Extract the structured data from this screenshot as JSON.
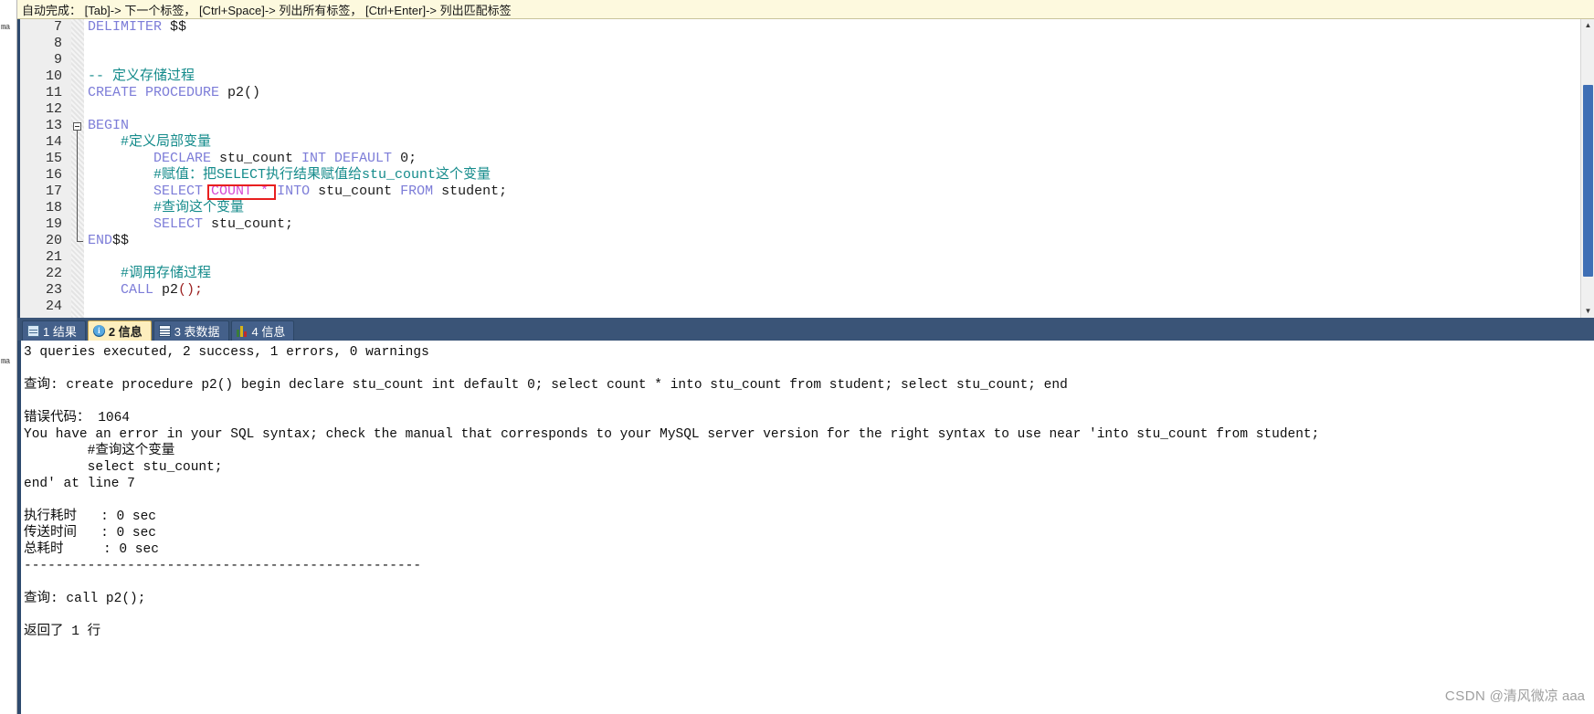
{
  "hint_bar": {
    "text": "自动完成： [Tab]-> 下一个标签， [Ctrl+Space]-> 列出所有标签， [Ctrl+Enter]-> 列出匹配标签"
  },
  "rail": {
    "label_top": "ma",
    "label_bottom": "ma"
  },
  "editor": {
    "lines": [
      {
        "no": "7",
        "segments": [
          {
            "t": "DELIMITER ",
            "c": "kw"
          },
          {
            "t": "$$",
            "c": "idn"
          }
        ]
      },
      {
        "no": "8",
        "segments": []
      },
      {
        "no": "9",
        "segments": []
      },
      {
        "no": "10",
        "segments": [
          {
            "t": "-- 定义存储过程",
            "c": "cmt"
          }
        ]
      },
      {
        "no": "11",
        "segments": [
          {
            "t": "CREATE PROCEDURE ",
            "c": "kw"
          },
          {
            "t": "p2",
            "c": "idn"
          },
          {
            "t": "()",
            "c": "idn"
          }
        ]
      },
      {
        "no": "12",
        "segments": []
      },
      {
        "no": "13",
        "segments": [
          {
            "t": "BEGIN",
            "c": "kw"
          }
        ]
      },
      {
        "no": "14",
        "segments": [
          {
            "t": "    #定义局部变量",
            "c": "cmt"
          }
        ]
      },
      {
        "no": "15",
        "segments": [
          {
            "t": "        DECLARE ",
            "c": "kw"
          },
          {
            "t": "stu_count ",
            "c": "idn"
          },
          {
            "t": "INT DEFAULT ",
            "c": "kw"
          },
          {
            "t": "0;",
            "c": "idn"
          }
        ]
      },
      {
        "no": "16",
        "segments": [
          {
            "t": "        #赋值：把SELECT执行结果赋值给stu_count这个变量",
            "c": "cmt"
          }
        ]
      },
      {
        "no": "17",
        "segments": [
          {
            "t": "        SELECT ",
            "c": "kw"
          },
          {
            "t": "COUNT *",
            "c": "hl"
          },
          {
            "t": " ",
            "c": "idn"
          },
          {
            "t": "INTO ",
            "c": "kw"
          },
          {
            "t": "stu_count ",
            "c": "idn"
          },
          {
            "t": "FROM ",
            "c": "kw"
          },
          {
            "t": "student;",
            "c": "idn"
          }
        ]
      },
      {
        "no": "18",
        "segments": [
          {
            "t": "        #查询这个变量",
            "c": "cmt"
          }
        ]
      },
      {
        "no": "19",
        "segments": [
          {
            "t": "        SELECT ",
            "c": "kw"
          },
          {
            "t": "stu_count;",
            "c": "idn"
          }
        ]
      },
      {
        "no": "20",
        "segments": [
          {
            "t": "END",
            "c": "kw"
          },
          {
            "t": "$$",
            "c": "idn"
          }
        ]
      },
      {
        "no": "21",
        "segments": []
      },
      {
        "no": "22",
        "segments": [
          {
            "t": "    #调用存储过程",
            "c": "cmt"
          }
        ]
      },
      {
        "no": "23",
        "segments": [
          {
            "t": "    CALL ",
            "c": "kw"
          },
          {
            "t": "p2",
            "c": "idn"
          },
          {
            "t": "()",
            "c": "punct"
          },
          {
            "t": ";",
            "c": "punct"
          }
        ]
      },
      {
        "no": "24",
        "segments": []
      }
    ],
    "annotation_color": "#e81f1f",
    "scrollbar": {
      "up_arrow": "▲",
      "down_arrow": "▼"
    }
  },
  "tabs": [
    {
      "label": "1 结果",
      "icon": "grid-icon",
      "active": false
    },
    {
      "label": "2 信息",
      "icon": "info-icon",
      "active": true
    },
    {
      "label": "3 表数据",
      "icon": "table-icon",
      "active": false
    },
    {
      "label": "4 信息",
      "icon": "chart-icon",
      "active": false
    }
  ],
  "messages": {
    "lines": [
      "3 queries executed, 2 success, 1 errors, 0 warnings",
      "",
      "查询: create procedure p2() begin declare stu_count int default 0; select count * into stu_count from student; select stu_count; end",
      "",
      "错误代码： 1064",
      "You have an error in your SQL syntax; check the manual that corresponds to your MySQL server version for the right syntax to use near 'into stu_count from student;",
      "        #查询这个变量",
      "        select stu_count;",
      "end' at line 7",
      "",
      "执行耗时   : 0 sec",
      "传送时间   : 0 sec",
      "总耗时     : 0 sec",
      "--------------------------------------------------",
      "",
      "查询: call p2();",
      "",
      "返回了 1 行"
    ]
  },
  "watermark": {
    "brand": "CSDN",
    "author": "@清风微凉 aaa"
  }
}
